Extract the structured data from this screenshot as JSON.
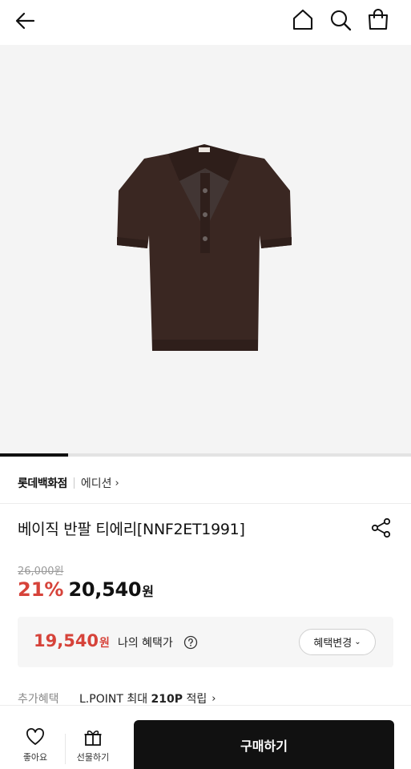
{
  "header": {
    "back_icon": "back-arrow-icon",
    "home_icon": "home-icon",
    "search_icon": "search-icon",
    "bag_icon": "shopping-bag-icon"
  },
  "gallery": {
    "image_alt": "brown short-sleeve knit polo shirt",
    "shirt_color": "#3a2722",
    "background": "#f4f4f4",
    "progress_fraction": 0.165
  },
  "brand": {
    "store": "롯데백화점",
    "brand_name": "에디션",
    "chevron": "›"
  },
  "product": {
    "title": "베이직 반팔 티에리[NNF2ET1991]",
    "share_icon": "share-icon"
  },
  "price": {
    "original": "26,000원",
    "discount": "21%",
    "sale_price": "20,540",
    "currency": "원",
    "accent_color": "#d6433a"
  },
  "benefit": {
    "my_price": "19,540",
    "currency": "원",
    "label": "나의 혜택가",
    "help_icon": "question-circle-icon",
    "change_button": "혜택변경",
    "dropdown_icon": "⌄"
  },
  "extra": {
    "label": "추가혜택",
    "value_prefix": "L.POINT 최대 ",
    "value_points": "210P",
    "value_suffix": " 적립",
    "chevron": "›"
  },
  "bottom": {
    "like_label": "좋아요",
    "gift_label": "선물하기",
    "buy_label": "구매하기"
  }
}
